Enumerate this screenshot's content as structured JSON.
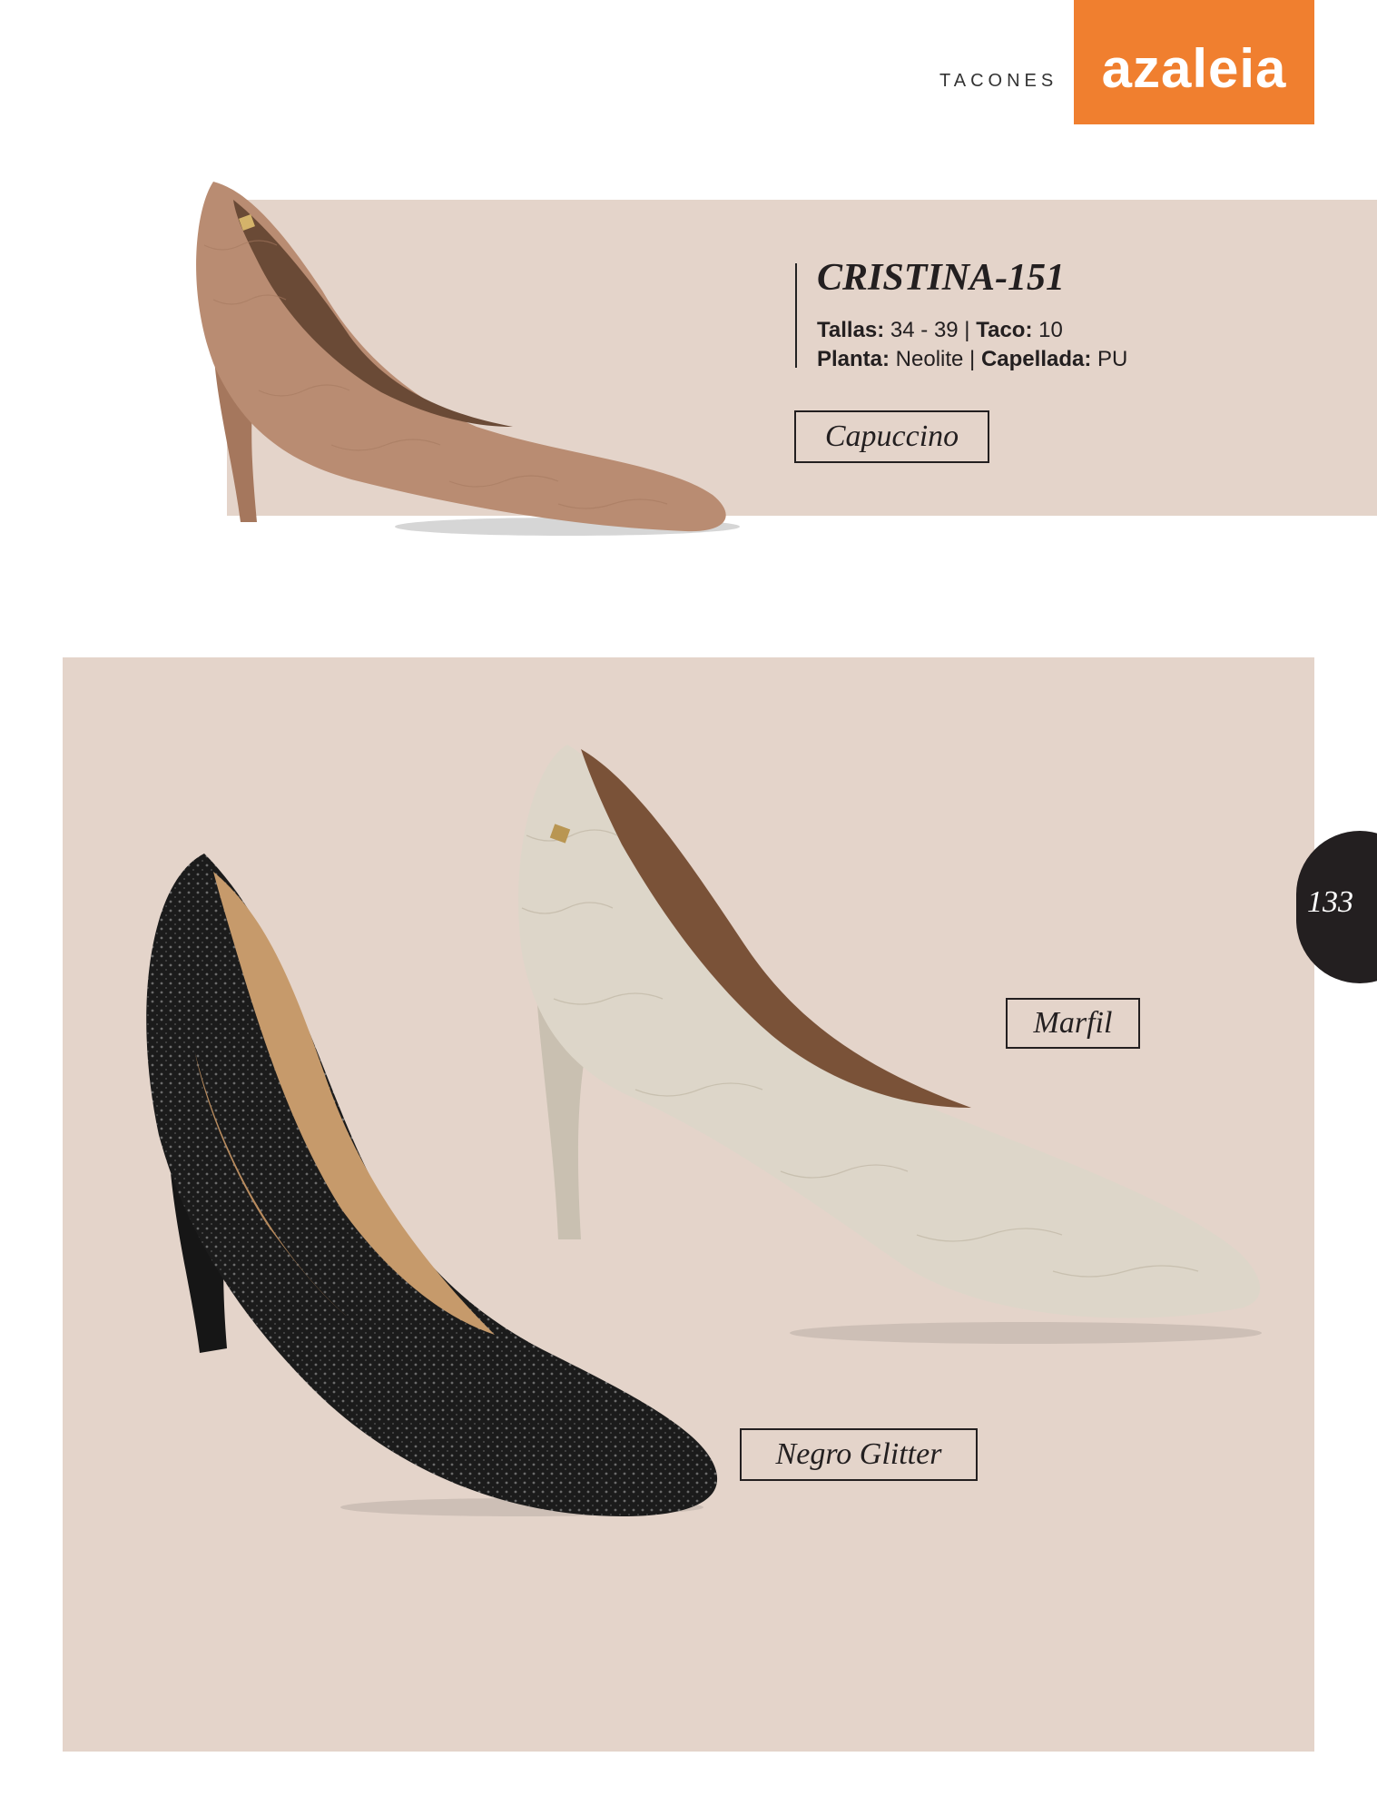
{
  "header": {
    "section": "TACONES",
    "brand": "azaleia"
  },
  "product": {
    "model": "CRISTINA-151",
    "specs": {
      "tallas_label": "Tallas:",
      "tallas_value": " 34 - 39",
      "sep1": " | ",
      "taco_label": "Taco:",
      "taco_value": " 10",
      "planta_label": "Planta:",
      "planta_value": " Neolite",
      "sep2": " | ",
      "capellada_label": "Capellada:",
      "capellada_value": " PU"
    },
    "colors": [
      "Capuccino",
      "Marfil",
      "Negro Glitter"
    ]
  },
  "page_number": "133",
  "palette": {
    "brand_orange": "#f07f2f",
    "panel": "#e4d4ca",
    "capuccino": "#b98c72",
    "marfil": "#ddd6c9",
    "negro": "#1b1b1b",
    "lining": "#c69a6b"
  },
  "icons": {
    "shoe_capuccino": "pointed-toe-pump",
    "shoe_marfil": "pointed-toe-pump",
    "shoe_negro": "pointed-toe-pump-glitter"
  }
}
